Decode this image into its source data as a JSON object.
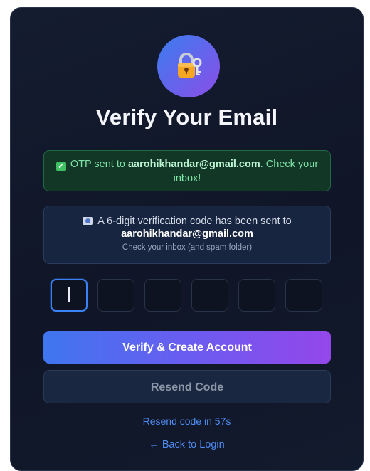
{
  "icon": "lock-with-key-icon",
  "title": "Verify Your Email",
  "success_alert": {
    "icon": "check-box-icon",
    "prefix": "OTP sent to ",
    "email": "aarohikhandar@gmail.com",
    "suffix": ". Check your inbox!"
  },
  "info_panel": {
    "icon": "envelope-icon",
    "message": "A 6-digit verification code has been sent to",
    "email": "aarohikhandar@gmail.com",
    "hint": "Check your inbox (and spam folder)"
  },
  "otp": {
    "digit_count": 6,
    "values": [
      "",
      "",
      "",
      "",
      "",
      ""
    ],
    "active_index": 0
  },
  "buttons": {
    "verify": "Verify & Create Account",
    "resend": "Resend Code"
  },
  "resend_timer": "Resend code in 57s",
  "back_link": "← Back to Login",
  "colors": {
    "accent_blue": "#3b82f6",
    "accent_purple": "#9447ea",
    "success_green": "#3fc062",
    "link": "#4f8df5",
    "card_bg": "#121a2d"
  }
}
